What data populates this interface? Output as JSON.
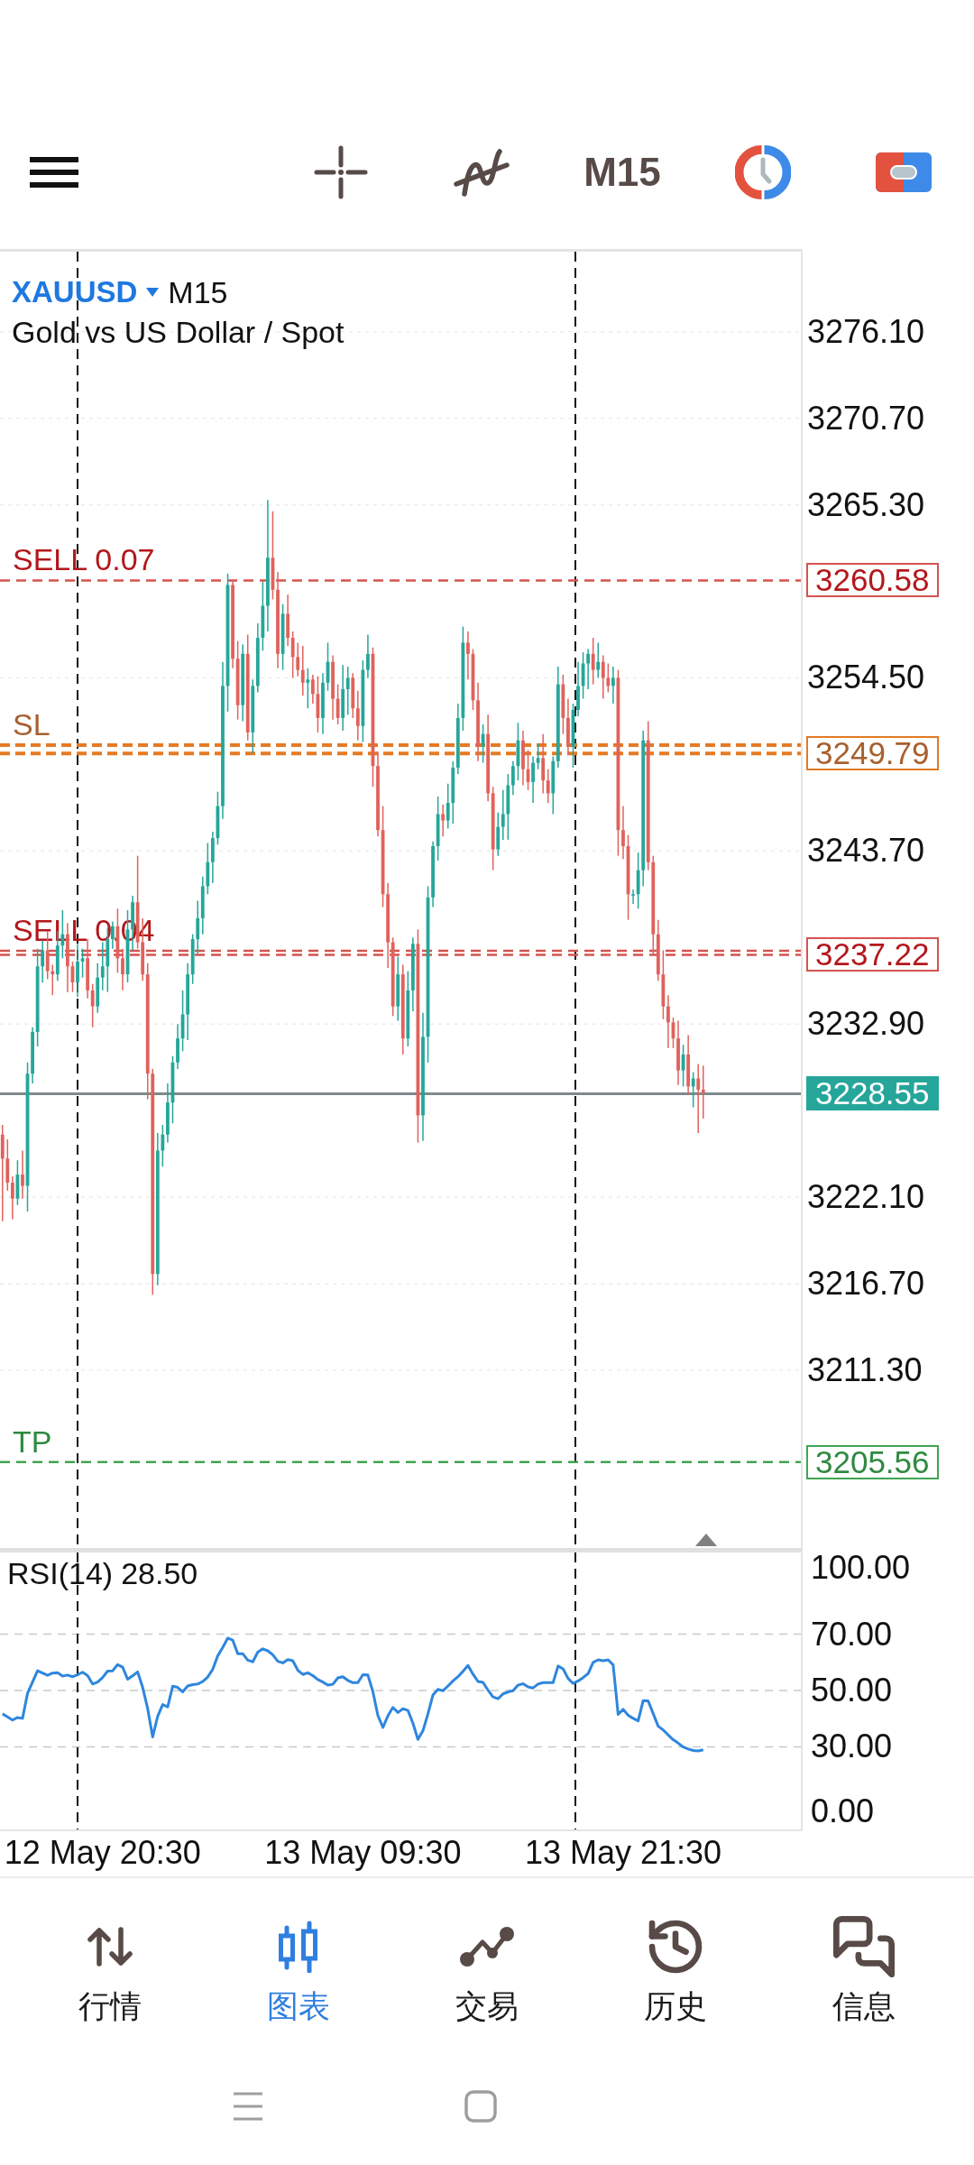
{
  "toolbar": {
    "timeframe": "M15"
  },
  "chart": {
    "symbol": "XAUUSD",
    "timeframe": "M15",
    "description": "Gold vs US Dollar / Spot",
    "trade_lines": [
      {
        "kind": "sell",
        "price_tag": "3260.58"
      },
      {
        "kind": "stop_loss"
      },
      {
        "kind": "stop_loss",
        "price_tag": "3249.79"
      },
      {
        "kind": "sell"
      },
      {
        "kind": "sell",
        "price_tag": "3237.22"
      },
      {
        "kind": "current",
        "price_tag": "3228.55"
      },
      {
        "kind": "take_profit",
        "price_tag": "3205.56"
      }
    ],
    "chart_data": {
      "type": "candlestick",
      "grid": true,
      "categories": [
        null,
        null,
        null,
        null,
        null,
        null,
        null,
        null,
        null,
        null,
        null,
        null,
        null,
        null,
        null,
        null,
        null,
        null,
        null,
        null,
        null,
        null,
        null,
        null,
        null,
        null,
        null,
        null,
        null,
        null,
        null,
        null,
        null,
        null,
        null,
        null,
        null,
        null,
        null,
        null,
        null,
        null,
        null,
        null,
        null,
        null,
        null,
        null,
        null,
        null,
        null,
        null,
        null,
        null,
        null,
        null,
        null,
        null,
        null,
        null,
        null,
        null,
        null,
        null,
        null,
        null,
        null,
        null,
        null,
        null,
        null,
        null,
        null,
        null,
        null,
        null,
        null,
        null,
        null,
        null,
        null,
        null,
        null,
        null,
        null,
        null,
        null,
        null,
        null,
        null,
        null,
        null,
        null,
        null,
        null,
        null,
        null,
        null,
        null,
        null,
        null,
        null,
        null,
        null,
        null,
        null,
        null,
        null,
        null,
        null,
        null,
        null,
        null,
        null,
        null,
        null,
        null,
        null,
        null,
        null,
        null,
        null,
        null,
        null,
        null,
        null,
        null,
        null,
        null,
        null,
        null,
        null,
        null,
        null,
        null,
        null,
        null,
        null,
        null,
        null,
        null,
        null,
        null,
        null,
        null,
        null,
        null,
        null,
        null,
        null,
        null,
        null,
        null,
        null,
        null,
        null,
        null,
        null,
        null,
        null
      ],
      "ohlc": [
        [
          3226,
          3226.6,
          3220.6,
          3224.5
        ],
        [
          3224.5,
          3225.7,
          3222.5,
          3223
        ],
        [
          3223,
          3223.4,
          3220.7,
          3222
        ],
        [
          3222,
          3224.4,
          3221.6,
          3223.5
        ],
        [
          3223.5,
          3225,
          3222,
          3222.8
        ],
        [
          3222.8,
          3230.5,
          3221.2,
          3229.8
        ],
        [
          3229.8,
          3232.7,
          3229.2,
          3232.4
        ],
        [
          3232.4,
          3237.6,
          3231.5,
          3236.5
        ],
        [
          3236.5,
          3238.1,
          3235.5,
          3237.5
        ],
        [
          3237.5,
          3238.7,
          3235.7,
          3236.2
        ],
        [
          3236.2,
          3236.6,
          3234.7,
          3236
        ],
        [
          3236,
          3238.7,
          3235.6,
          3237.8
        ],
        [
          3237.8,
          3240,
          3237,
          3238.5
        ],
        [
          3238.5,
          3239.2,
          3234.9,
          3236.5
        ],
        [
          3236.5,
          3236.8,
          3234.9,
          3235.5
        ],
        [
          3235.5,
          3237.9,
          3234.6,
          3236.8
        ],
        [
          3236.8,
          3237.6,
          3235.8,
          3237
        ],
        [
          3237,
          3238.2,
          3234.5,
          3235
        ],
        [
          3235,
          3235.4,
          3232.7,
          3234
        ],
        [
          3234,
          3236.7,
          3233.6,
          3235.8
        ],
        [
          3235.8,
          3238,
          3235,
          3236.5
        ],
        [
          3236.5,
          3238.9,
          3234.9,
          3238.2
        ],
        [
          3238.2,
          3239.3,
          3237.6,
          3239
        ],
        [
          3239,
          3240.1,
          3236.1,
          3237
        ],
        [
          3237,
          3237.6,
          3235,
          3236
        ],
        [
          3236,
          3240,
          3235.5,
          3238.8
        ],
        [
          3238.8,
          3240.9,
          3237.5,
          3240.5
        ],
        [
          3240.5,
          3243.4,
          3237.6,
          3238
        ],
        [
          3238,
          3239.5,
          3235.6,
          3236
        ],
        [
          3236,
          3236.7,
          3228.2,
          3229.8
        ],
        [
          3229.8,
          3230.1,
          3216,
          3217.3
        ],
        [
          3217.3,
          3226.1,
          3216.6,
          3225
        ],
        [
          3225,
          3226.6,
          3224,
          3226
        ],
        [
          3226,
          3229.2,
          3225.5,
          3228
        ],
        [
          3228,
          3230.9,
          3226.7,
          3230.5
        ],
        [
          3230.5,
          3232.9,
          3230.1,
          3232
        ],
        [
          3232,
          3235,
          3231.2,
          3233.5
        ],
        [
          3233.5,
          3236.7,
          3231.9,
          3236
        ],
        [
          3236,
          3238.5,
          3235.4,
          3238.2
        ],
        [
          3238.2,
          3240.6,
          3237.3,
          3239.5
        ],
        [
          3239.5,
          3242.1,
          3238.5,
          3241.5
        ],
        [
          3241.5,
          3244.2,
          3241,
          3243
        ],
        [
          3243,
          3244.9,
          3241.7,
          3244.5
        ],
        [
          3244.5,
          3247.4,
          3244.1,
          3246.5
        ],
        [
          3246.5,
          3255.5,
          3245.7,
          3254
        ],
        [
          3254,
          3261,
          3252.4,
          3260.3
        ],
        [
          3260.3,
          3260.6,
          3255.1,
          3255.7
        ],
        [
          3255.7,
          3256.8,
          3251.9,
          3252.8
        ],
        [
          3252.8,
          3256.6,
          3251.8,
          3256
        ],
        [
          3256,
          3257.2,
          3250.6,
          3251.1
        ],
        [
          3251.1,
          3254.4,
          3249.8,
          3254
        ],
        [
          3254,
          3257.9,
          3253.6,
          3257
        ],
        [
          3257,
          3260.5,
          3256.2,
          3259
        ],
        [
          3259,
          3265.6,
          3257.4,
          3262
        ],
        [
          3262,
          3264.9,
          3259.4,
          3260
        ],
        [
          3260,
          3261.1,
          3255.1,
          3256
        ],
        [
          3256,
          3259.1,
          3255,
          3258.5
        ],
        [
          3258.5,
          3259.7,
          3256.5,
          3257
        ],
        [
          3257,
          3257.4,
          3254.5,
          3255.8
        ],
        [
          3255.8,
          3256.7,
          3254.6,
          3255
        ],
        [
          3255,
          3256.5,
          3253.4,
          3254.2
        ],
        [
          3254.2,
          3255.1,
          3252.6,
          3254.4
        ],
        [
          3254.4,
          3254.7,
          3252.9,
          3253.5
        ],
        [
          3253.5,
          3254.6,
          3251.1,
          3252
        ],
        [
          3252,
          3254.8,
          3251,
          3254.2
        ],
        [
          3254.2,
          3256.7,
          3253.7,
          3255.5
        ],
        [
          3255.5,
          3255.9,
          3251.9,
          3253.2
        ],
        [
          3253.2,
          3254.1,
          3251.6,
          3252
        ],
        [
          3252,
          3255.3,
          3251.2,
          3253.8
        ],
        [
          3253.8,
          3255.2,
          3252.2,
          3254.5
        ],
        [
          3254.5,
          3254.8,
          3252,
          3252.6
        ],
        [
          3252.6,
          3253.7,
          3250.6,
          3251.5
        ],
        [
          3251.5,
          3255.6,
          3250.5,
          3255
        ],
        [
          3255,
          3257.2,
          3254.5,
          3256
        ],
        [
          3256,
          3256.4,
          3247.7,
          3249
        ],
        [
          3249,
          3249.9,
          3244.6,
          3245
        ],
        [
          3245,
          3246.5,
          3240.2,
          3241
        ],
        [
          3241,
          3241.7,
          3236.4,
          3238
        ],
        [
          3238,
          3238.3,
          3233.4,
          3234
        ],
        [
          3234,
          3237.1,
          3233.1,
          3236
        ],
        [
          3236,
          3236.6,
          3231,
          3232
        ],
        [
          3232,
          3236.2,
          3231.5,
          3235
        ],
        [
          3235,
          3238.3,
          3233.7,
          3237.9
        ],
        [
          3237.9,
          3238.8,
          3225.5,
          3227.2
        ],
        [
          3227.2,
          3233.6,
          3225.6,
          3232.1
        ],
        [
          3232.1,
          3241.5,
          3230.5,
          3240.8
        ],
        [
          3240.8,
          3244.3,
          3240.2,
          3244
        ],
        [
          3244,
          3247.1,
          3243.1,
          3246
        ],
        [
          3246,
          3246.6,
          3244.6,
          3245.6
        ],
        [
          3245.6,
          3247.9,
          3245.1,
          3246.7
        ],
        [
          3246.7,
          3249.3,
          3245.4,
          3248.9
        ],
        [
          3248.9,
          3252.9,
          3248.5,
          3252
        ],
        [
          3252,
          3257.7,
          3251.2,
          3256.7
        ],
        [
          3256.7,
          3257.4,
          3254.4,
          3256
        ],
        [
          3256,
          3256.3,
          3252.5,
          3253.1
        ],
        [
          3253.1,
          3254.2,
          3249.3,
          3250.2
        ],
        [
          3250.2,
          3251.6,
          3249.2,
          3251
        ],
        [
          3251,
          3252.2,
          3246.8,
          3247.3
        ],
        [
          3247.3,
          3247.7,
          3242.5,
          3243.8
        ],
        [
          3243.8,
          3246.1,
          3243.4,
          3245.2
        ],
        [
          3245.2,
          3247.5,
          3244.4,
          3246
        ],
        [
          3246,
          3248.5,
          3244.4,
          3247.8
        ],
        [
          3247.8,
          3249.3,
          3247.2,
          3249
        ],
        [
          3249,
          3251.7,
          3248.1,
          3250.6
        ],
        [
          3250.6,
          3251.2,
          3247.8,
          3248.8
        ],
        [
          3248.8,
          3250,
          3247.5,
          3248
        ],
        [
          3248,
          3249.6,
          3246.7,
          3249.2
        ],
        [
          3249.2,
          3250.4,
          3248.8,
          3249.5
        ],
        [
          3249.5,
          3251,
          3247.3,
          3248.1
        ],
        [
          3248.1,
          3248.8,
          3246.7,
          3247.3
        ],
        [
          3247.3,
          3249.6,
          3246,
          3249.3
        ],
        [
          3249.3,
          3255.2,
          3248.9,
          3254.1
        ],
        [
          3254.1,
          3254.7,
          3251,
          3252
        ],
        [
          3252,
          3253.2,
          3249.7,
          3250.2
        ],
        [
          3250.2,
          3252.9,
          3248.9,
          3252.5
        ],
        [
          3252.5,
          3255.5,
          3252.1,
          3254
        ],
        [
          3254,
          3256.1,
          3253.2,
          3255.4
        ],
        [
          3255.4,
          3256.3,
          3253.8,
          3256
        ],
        [
          3256,
          3257,
          3254.1,
          3255
        ],
        [
          3255,
          3256.7,
          3254.5,
          3255.5
        ],
        [
          3255.5,
          3255.9,
          3253.2,
          3254.5
        ],
        [
          3254.5,
          3255.4,
          3253.6,
          3254
        ],
        [
          3254,
          3255.2,
          3252.9,
          3254.5
        ],
        [
          3254.5,
          3255,
          3243.4,
          3245
        ],
        [
          3245,
          3246.5,
          3243.2,
          3244
        ],
        [
          3244,
          3244.7,
          3239.4,
          3241
        ],
        [
          3241,
          3241.3,
          3240.4,
          3241
        ],
        [
          3241,
          3243.6,
          3240.1,
          3242.5
        ],
        [
          3242.5,
          3251.2,
          3241.5,
          3250.6
        ],
        [
          3250.6,
          3251.8,
          3242.5,
          3243
        ],
        [
          3243,
          3243.4,
          3237.2,
          3238.5
        ],
        [
          3238.5,
          3239.4,
          3235.6,
          3236
        ],
        [
          3236,
          3237.5,
          3233.2,
          3234
        ],
        [
          3234,
          3234.7,
          3231.4,
          3233
        ],
        [
          3233,
          3233.3,
          3231.4,
          3232
        ],
        [
          3232,
          3233.1,
          3229.1,
          3230
        ],
        [
          3230,
          3231.6,
          3229,
          3231
        ],
        [
          3231,
          3232.2,
          3228.5,
          3229
        ],
        [
          3229,
          3229.9,
          3227.7,
          3229.5
        ],
        [
          3229.5,
          3230.4,
          3226.1,
          3228.8
        ],
        [
          3228.8,
          3230.3,
          3227,
          3228.6
        ],
        null,
        null,
        null,
        null,
        null,
        null,
        null,
        null,
        null,
        null,
        null,
        null,
        null,
        null,
        null,
        null,
        null,
        null,
        null
      ],
      "ylim": [
        3200.2,
        3281.1
      ],
      "yticks": [
        {
          "value": 3276.1,
          "label": "3276.10"
        },
        {
          "value": 3270.7,
          "label": "3270.70"
        },
        {
          "value": 3265.3,
          "label": "3265.30"
        },
        {
          "value": 3254.5,
          "label": "3254.50"
        },
        {
          "value": 3243.7,
          "label": "3243.70"
        },
        {
          "value": 3232.9,
          "label": "3232.90"
        },
        {
          "value": 3222.1,
          "label": "3222.10"
        },
        {
          "value": 3216.7,
          "label": "3216.70"
        },
        {
          "value": 3211.3,
          "label": "3211.30"
        }
      ],
      "ref_lines": [
        {
          "axis": "y",
          "value": 3260.58,
          "color": "#d4534f",
          "label": "SELL 0.07"
        },
        {
          "axis": "y",
          "value": 3250.3,
          "color": "#e67a22"
        },
        {
          "axis": "y",
          "value": 3249.79,
          "color": "#e67a22",
          "label": "SL"
        },
        {
          "axis": "y",
          "value": 3237.47,
          "color": "#d4534f"
        },
        {
          "axis": "y",
          "value": 3237.22,
          "color": "#d4534f",
          "label": "SELL 0.04"
        },
        {
          "axis": "y",
          "value": 3228.55,
          "color": "#7f8a8c"
        },
        {
          "axis": "y",
          "value": 3205.56,
          "color": "#3fa553",
          "label": "TP"
        }
      ]
    }
  },
  "indicator": {
    "reading": "28.50",
    "chart_data": {
      "type": "line",
      "grid": true,
      "categories": [
        null,
        null,
        null,
        null,
        null,
        null,
        null,
        null,
        null,
        null,
        null,
        null,
        null,
        null,
        null,
        null,
        null,
        null,
        null,
        null,
        "12 May 20:30",
        null,
        null,
        null,
        null,
        null,
        null,
        null,
        null,
        null,
        null,
        null,
        null,
        null,
        null,
        null,
        null,
        null,
        null,
        null,
        null,
        null,
        null,
        null,
        null,
        null,
        null,
        null,
        null,
        null,
        null,
        null,
        null,
        null,
        null,
        null,
        null,
        null,
        null,
        null,
        null,
        null,
        null,
        null,
        null,
        null,
        null,
        null,
        null,
        null,
        null,
        null,
        "13 May 09:30",
        null,
        null,
        null,
        null,
        null,
        null,
        null,
        null,
        null,
        null,
        null,
        null,
        null,
        null,
        null,
        null,
        null,
        null,
        null,
        null,
        null,
        null,
        null,
        null,
        null,
        null,
        null,
        null,
        null,
        null,
        null,
        null,
        null,
        null,
        null,
        null,
        null,
        null,
        null,
        null,
        null,
        null,
        null,
        null,
        null,
        null,
        null,
        null,
        null,
        null,
        null,
        "13 May 21:30",
        null,
        null,
        null,
        null,
        null,
        null,
        null,
        null,
        null,
        null,
        null,
        null,
        null,
        null,
        null,
        null,
        null,
        null,
        null,
        null,
        null,
        null,
        null,
        null,
        null,
        null,
        null,
        null,
        null,
        null,
        null,
        null,
        null,
        null,
        null
      ],
      "series": [
        {
          "name": "RSI(14)",
          "color": "#2e86de",
          "values": [
            41.7,
            40.6,
            39.5,
            40.4,
            40.1,
            49,
            53,
            57,
            56.2,
            55.4,
            56.2,
            56.3,
            55.1,
            55.5,
            54.9,
            55.6,
            56.5,
            55.3,
            52.3,
            53,
            54.6,
            56.9,
            57,
            59.2,
            58.3,
            54,
            55.2,
            56.6,
            51.1,
            43.6,
            33.5,
            40.8,
            45,
            44.2,
            51.5,
            51.1,
            49.5,
            51.6,
            52.1,
            52.3,
            53.2,
            54.8,
            57.5,
            62.3,
            65.3,
            68.6,
            67.9,
            63.1,
            63.1,
            60.8,
            60.2,
            63.6,
            64.8,
            64.1,
            62.7,
            60.4,
            59.8,
            61,
            60.6,
            57.2,
            55.7,
            56.3,
            55.3,
            53.9,
            53,
            51.9,
            52.2,
            54.5,
            54.9,
            53.6,
            52.8,
            52.8,
            55.6,
            55.5,
            49.6,
            41.1,
            36.9,
            41,
            44,
            42.2,
            43.5,
            42.9,
            38.4,
            32.6,
            35.7,
            41.7,
            48.4,
            50.4,
            49.9,
            51.6,
            53.4,
            54.9,
            56.8,
            58.9,
            55.8,
            53.2,
            52.9,
            50.1,
            47.7,
            47.1,
            48.8,
            49.5,
            49.9,
            51.9,
            52.4,
            51.3,
            50.9,
            52.3,
            52.8,
            52.8,
            52.8,
            58.7,
            57.7,
            54.3,
            52.5,
            53.4,
            54.6,
            56,
            60,
            60.9,
            60.6,
            60.9,
            59.1,
            41.5,
            43.3,
            41.2,
            40.1,
            39.2,
            46.4,
            46.3,
            41.8,
            37.3,
            36,
            34.2,
            32.5,
            31.3,
            29.9,
            29.2,
            28.7,
            28.5,
            28.9,
            null,
            null,
            null,
            null,
            null,
            null,
            null,
            null,
            null,
            null,
            null,
            null,
            null,
            null,
            null,
            null,
            null,
            null,
            null
          ]
        }
      ],
      "ylim": [
        0,
        100
      ],
      "yticks": [
        {
          "value": 100,
          "label": "100.00"
        },
        {
          "value": 70,
          "label": "70.00"
        },
        {
          "value": 50,
          "label": "50.00"
        },
        {
          "value": 30,
          "label": "30.00"
        },
        {
          "value": 0,
          "label": "0.00"
        }
      ]
    }
  },
  "bottom_nav": {
    "tabs": [
      {
        "label": "行情",
        "selected": false
      },
      {
        "label": "图表",
        "selected": true
      },
      {
        "label": "交易",
        "selected": false
      },
      {
        "label": "历史",
        "selected": false
      },
      {
        "label": "信息",
        "selected": false
      }
    ]
  }
}
